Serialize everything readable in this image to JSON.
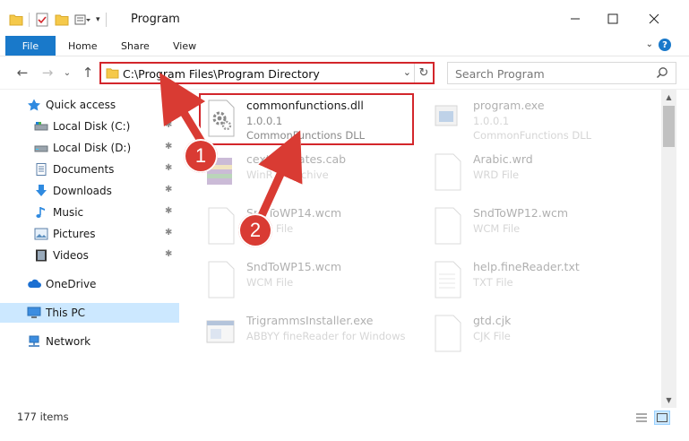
{
  "window": {
    "title": "Program",
    "minimize_glyph": "—",
    "maximize_glyph": "☐",
    "close_glyph": "✕"
  },
  "ribbon": {
    "file_tab": "File",
    "tabs": [
      "Home",
      "Share",
      "View"
    ],
    "help": "?"
  },
  "nav": {
    "back": "←",
    "forward": "→",
    "recent": "⌄",
    "up": "↑",
    "address_path": "C:\\Program Files\\Program Directory",
    "address_dropdown": "⌄",
    "refresh": "↻",
    "search_placeholder": "Search Program"
  },
  "sidebar": {
    "items": [
      {
        "label": "Quick access",
        "icon": "star-icon",
        "pinned": false
      },
      {
        "label": "Local Disk (C:)",
        "icon": "drive-icon",
        "pinned": true
      },
      {
        "label": "Local Disk (D:)",
        "icon": "drive-icon",
        "pinned": true
      },
      {
        "label": "Documents",
        "icon": "documents-icon",
        "pinned": true
      },
      {
        "label": "Downloads",
        "icon": "download-icon",
        "pinned": true
      },
      {
        "label": "Music",
        "icon": "music-icon",
        "pinned": true
      },
      {
        "label": "Pictures",
        "icon": "pictures-icon",
        "pinned": true
      },
      {
        "label": "Videos",
        "icon": "videos-icon",
        "pinned": true
      },
      {
        "label": "OneDrive",
        "icon": "cloud-icon",
        "pinned": false
      },
      {
        "label": "This PC",
        "icon": "pc-icon",
        "pinned": false,
        "selected": true
      },
      {
        "label": "Network",
        "icon": "network-icon",
        "pinned": false
      }
    ],
    "pin_glyph": "📌"
  },
  "files": [
    {
      "name": "commonfunctions.dll",
      "line2": "1.0.0.1",
      "line3": "CommonFunctions DLL",
      "icon": "dll-gear-icon",
      "highlighted": true
    },
    {
      "name": "program.exe",
      "line2": "1.0.0.1",
      "line3": "CommonFunctions DLL",
      "icon": "exe-icon"
    },
    {
      "name": "cextemplates.cab",
      "line2": "WinRAR Archive",
      "line3": "",
      "icon": "winrar-icon"
    },
    {
      "name": "Arabic.wrd",
      "line2": "WRD File",
      "line3": "",
      "icon": "blank-file-icon"
    },
    {
      "name": "SndToWP14.wcm",
      "line2": "WCM File",
      "line3": "",
      "icon": "blank-file-icon"
    },
    {
      "name": "SndToWP12.wcm",
      "line2": "WCM File",
      "line3": "",
      "icon": "blank-file-icon"
    },
    {
      "name": "SndToWP15.wcm",
      "line2": "WCM File",
      "line3": "",
      "icon": "blank-file-icon"
    },
    {
      "name": "help.fineReader.txt",
      "line2": "TXT File",
      "line3": "",
      "icon": "text-file-icon"
    },
    {
      "name": "TrigrammsInstaller.exe",
      "line2": "ABBYY fineReader for Windows",
      "line3": "",
      "icon": "installer-icon"
    },
    {
      "name": "gtd.cjk",
      "line2": "CJK File",
      "line3": "",
      "icon": "blank-file-icon"
    }
  ],
  "annotations": {
    "step1": "1",
    "step2": "2",
    "color": "#d93b33"
  },
  "status": {
    "item_count": "177 items"
  },
  "colors": {
    "accent": "#1979ca",
    "highlight_box": "#d3262b",
    "selection": "#cce8ff"
  }
}
